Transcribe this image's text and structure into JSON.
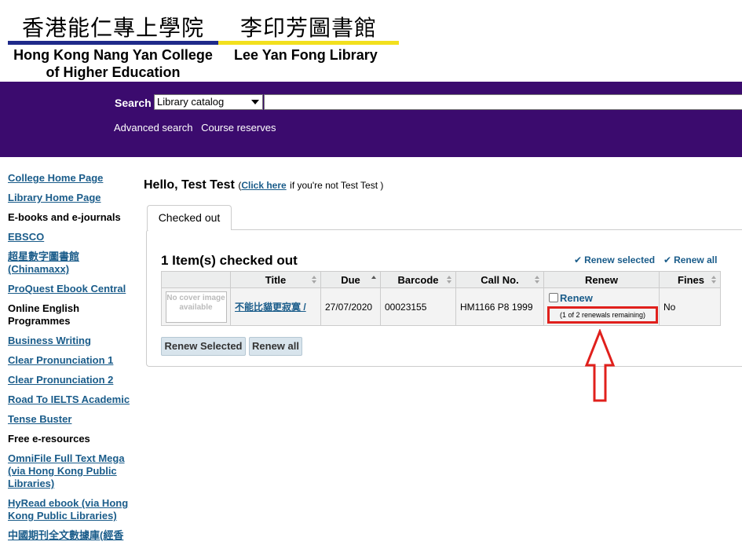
{
  "header": {
    "college_zh": "香港能仁專上學院",
    "library_zh": "李印芳圖書館",
    "college_en_line1": "Hong Kong Nang Yan College",
    "college_en_line2": "of Higher Education",
    "library_en": "Lee Yan Fong Library",
    "bar_colors": [
      "#1f2a8a",
      "#f2e01e"
    ]
  },
  "search": {
    "label": "Search",
    "selected_option": "Library catalog",
    "query_value": "",
    "links": [
      "Advanced search",
      "Course reserves"
    ],
    "band_color": "#3b0b6e"
  },
  "sidebar": {
    "items": [
      {
        "label": "College Home Page",
        "link": true
      },
      {
        "label": "Library Home Page",
        "link": true
      },
      {
        "label": "E-books and e-journals",
        "link": false
      },
      {
        "label": "EBSCO",
        "link": true
      },
      {
        "label": "超星數字圖書館 (Chinamaxx)",
        "link": true
      },
      {
        "label": "ProQuest Ebook Central",
        "link": true
      },
      {
        "label": "Online English Programmes",
        "link": false
      },
      {
        "label": "Business Writing",
        "link": true
      },
      {
        "label": "Clear Pronunciation 1",
        "link": true
      },
      {
        "label": "Clear Pronunciation 2",
        "link": true
      },
      {
        "label": "Road To IELTS Academic",
        "link": true
      },
      {
        "label": "Tense Buster",
        "link": true
      },
      {
        "label": "Free e-resources",
        "link": false
      },
      {
        "label": "OmniFile Full Text Mega (via Hong Kong Public Libraries)",
        "link": true
      },
      {
        "label": "HyRead ebook (via Hong Kong Public Libraries)",
        "link": true
      },
      {
        "label": "中國期刊全文數據庫(經香",
        "link": true
      }
    ]
  },
  "greeting": {
    "hello": "Hello, Test Test",
    "paren_open": "(",
    "click_here": "Click here",
    "rest": "if you're not Test Test )"
  },
  "tabs": [
    {
      "label": "Checked out"
    }
  ],
  "checkouts": {
    "count_title": "1 Item(s) checked out",
    "renew_selected_link": "Renew selected",
    "renew_all_link": "Renew all",
    "columns": [
      "",
      "Title",
      "Due",
      "Barcode",
      "Call No.",
      "Renew",
      "Fines"
    ],
    "rows": [
      {
        "cover_text": "No cover image available",
        "title": "不能比貓更寂寞 /",
        "due": "27/07/2020",
        "barcode": "00023155",
        "call_no": "HM1166 P8 1999",
        "renew_label": "Renew",
        "renew_note": "(1 of 2 renewals remaining)",
        "fines": "No"
      }
    ],
    "buttons": {
      "renew_selected": "Renew Selected",
      "renew_all": "Renew all"
    }
  },
  "annotation": {
    "highlight_color": "#e0201c",
    "shape": "up-arrow"
  }
}
